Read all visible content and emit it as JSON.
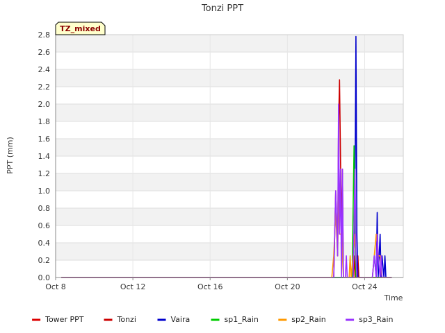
{
  "chart_data": {
    "type": "line",
    "title": "Tonzi PPT",
    "xlabel": "Time",
    "ylabel": "PPT (mm)",
    "badge": "TZ_mixed",
    "xlim": [
      8.0,
      26.0
    ],
    "ylim": [
      0.0,
      2.8
    ],
    "x_unit": "day of October",
    "x_ticks": [
      {
        "value": 8,
        "label": "Oct 8"
      },
      {
        "value": 12,
        "label": "Oct 12"
      },
      {
        "value": 16,
        "label": "Oct 16"
      },
      {
        "value": 20,
        "label": "Oct 20"
      },
      {
        "value": 24,
        "label": "Oct 24"
      }
    ],
    "y_ticks": [
      "0.0",
      "0.2",
      "0.4",
      "0.6",
      "0.8",
      "1.0",
      "1.2",
      "1.4",
      "1.6",
      "1.8",
      "2.0",
      "2.2",
      "2.4",
      "2.6",
      "2.8"
    ],
    "grid": true,
    "legend_position": "bottom",
    "series": [
      {
        "name": "Tower PPT",
        "color": "#dd0000",
        "x": [
          8.3,
          25.4
        ],
        "y": [
          0,
          0
        ]
      },
      {
        "name": "Tonzi",
        "color": "#cc0000",
        "x": [
          8.3,
          22.4,
          22.5,
          22.6,
          22.65,
          22.7,
          22.8,
          22.85,
          22.9,
          23.0,
          23.4,
          23.45,
          23.5,
          23.55,
          23.6,
          23.65,
          23.7,
          25.4
        ],
        "y": [
          0,
          0,
          1.0,
          0.25,
          1.75,
          2.28,
          0.5,
          1.25,
          0,
          0,
          0,
          0.25,
          0,
          0.25,
          0,
          0.25,
          0,
          0
        ]
      },
      {
        "name": "Vaira",
        "color": "#0000cc",
        "x": [
          8.3,
          23.4,
          23.5,
          23.55,
          23.6,
          23.65,
          24.4,
          24.5,
          24.6,
          24.65,
          24.7,
          24.8,
          24.85,
          24.9,
          25.0,
          25.05,
          25.1,
          25.4
        ],
        "y": [
          0,
          0,
          1.0,
          2.78,
          0.5,
          0,
          0,
          0.25,
          0,
          0.75,
          0,
          0.5,
          0,
          0.25,
          0,
          0.25,
          0,
          0
        ]
      },
      {
        "name": "sp1_Rain",
        "color": "#00cc00",
        "x": [
          8.3,
          23.35,
          23.45,
          23.5,
          23.55,
          25.4
        ],
        "y": [
          0,
          0,
          1.52,
          0.5,
          0,
          0
        ]
      },
      {
        "name": "sp2_Rain",
        "color": "#ff9900",
        "x": [
          8.3,
          22.3,
          22.4,
          22.5,
          22.6,
          22.65,
          22.7,
          22.8,
          22.9,
          23.2,
          23.25,
          23.3,
          23.4,
          23.5,
          23.6,
          24.4,
          24.5,
          24.6,
          24.7,
          24.8,
          24.9,
          25.4
        ],
        "y": [
          0,
          0,
          0.25,
          0.75,
          0.25,
          1.0,
          0.5,
          0.5,
          0,
          0,
          0.25,
          0,
          0.25,
          0.5,
          0,
          0,
          0.25,
          0.5,
          0.25,
          0.25,
          0,
          0
        ]
      },
      {
        "name": "sp3_Rain",
        "color": "#9933ff",
        "x": [
          8.3,
          22.4,
          22.5,
          22.6,
          22.65,
          22.7,
          22.75,
          22.8,
          22.85,
          22.9,
          23.0,
          23.05,
          23.1,
          23.4,
          23.5,
          23.55,
          23.6,
          24.4,
          24.5,
          24.6,
          24.65,
          24.7,
          24.8,
          24.85,
          24.9,
          25.0,
          25.4
        ],
        "y": [
          0,
          0,
          1.0,
          0.25,
          2.0,
          0.5,
          1.25,
          0,
          1.25,
          0,
          0,
          0.25,
          0,
          0,
          1.25,
          0.25,
          0,
          0,
          0.25,
          0,
          0.5,
          0.25,
          0,
          0.25,
          0,
          0,
          0
        ]
      }
    ]
  }
}
